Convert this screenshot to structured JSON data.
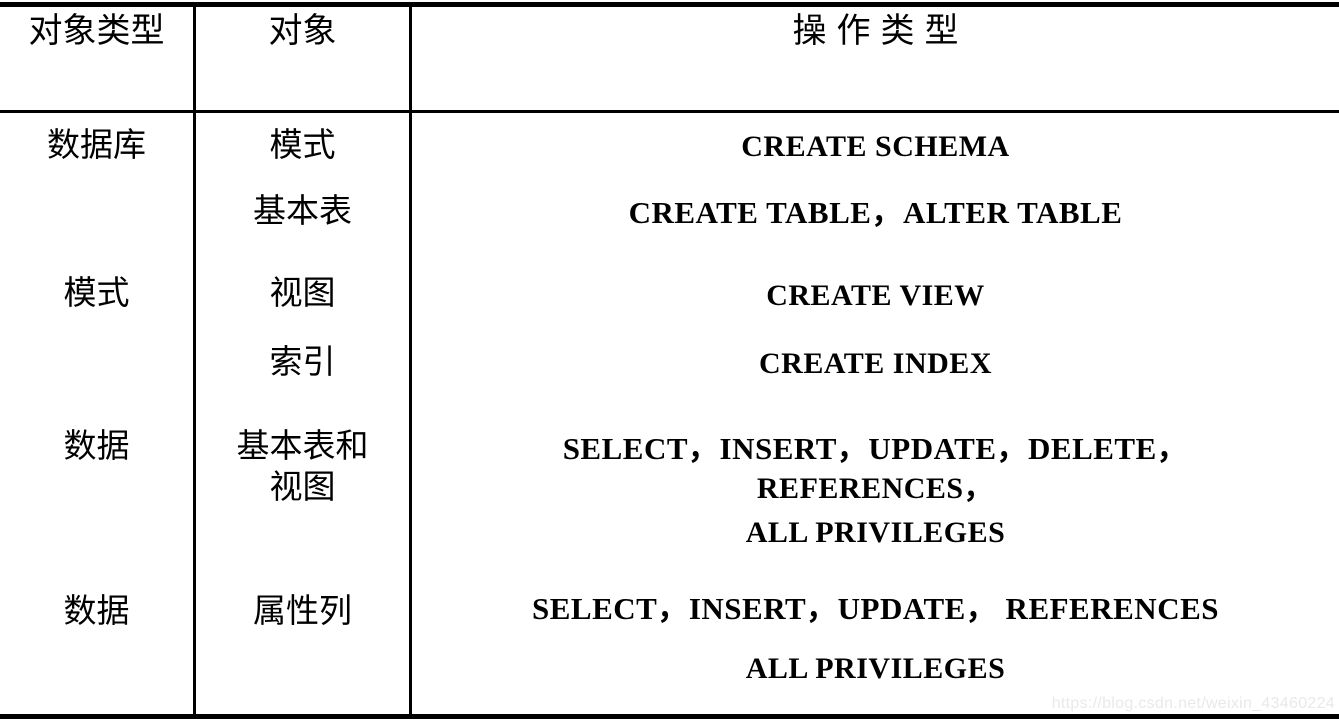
{
  "table": {
    "headers": [
      {
        "label": "对象类型"
      },
      {
        "label": "对象"
      },
      {
        "label": "操作类型"
      }
    ],
    "rows": [
      {
        "object_type": "数据库",
        "object": "模式",
        "operations": [
          "CREATE SCHEMA"
        ]
      },
      {
        "object_type": "",
        "object": "基本表",
        "operations": [
          "CREATE TABLE，ALTER TABLE"
        ]
      },
      {
        "object_type": "模式",
        "object": "视图",
        "operations": [
          "CREATE VIEW"
        ]
      },
      {
        "object_type": "",
        "object": "索引",
        "operations": [
          "CREATE INDEX"
        ]
      },
      {
        "object_type": "数据",
        "object": "基本表和视图",
        "object_line1": "基本表和",
        "object_line2": "视图",
        "operations": [
          "SELECT，INSERT，UPDATE，DELETE，",
          "REFERENCES，",
          "ALL PRIVILEGES"
        ]
      },
      {
        "object_type": "数据",
        "object": "属性列",
        "operations": [
          "SELECT，INSERT，UPDATE， REFERENCES",
          "ALL PRIVILEGES"
        ]
      }
    ]
  },
  "watermark": {
    "text": "https://blog.csdn.net/weixin_43460224"
  },
  "colors": {
    "rule": "#000000",
    "text": "#000000",
    "background": "#ffffff",
    "watermark": "#e9e9e9"
  }
}
